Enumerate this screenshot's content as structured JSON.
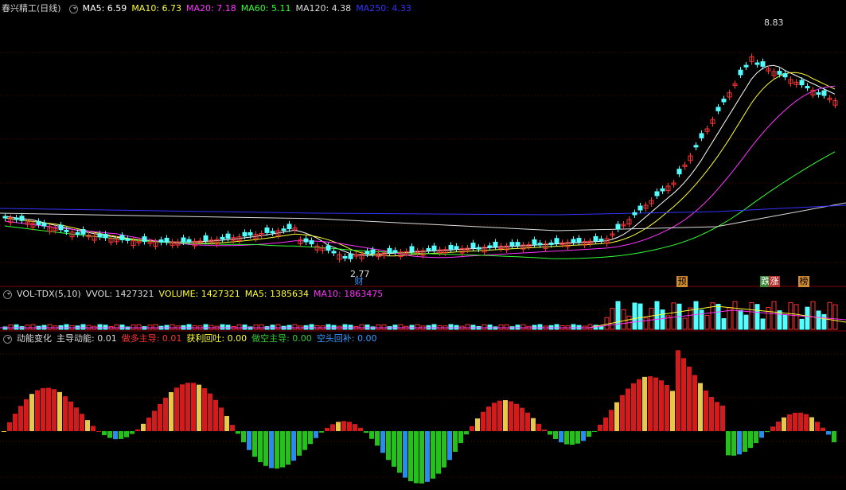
{
  "stock": {
    "name": "春兴精工",
    "period": "(日线)"
  },
  "ma_legend": [
    {
      "label": "MA5: 6.59",
      "color": "#ffffff"
    },
    {
      "label": "MA10: 6.73",
      "color": "#ffff33"
    },
    {
      "label": "MA20: 7.18",
      "color": "#ff33ff"
    },
    {
      "label": "MA60: 5.11",
      "color": "#33ff33"
    },
    {
      "label": "MA120: 4.38",
      "color": "#dddddd"
    },
    {
      "label": "MA250: 4.33",
      "color": "#3333ff"
    }
  ],
  "price": {
    "high_label": "8.83",
    "low_label": "2.77"
  },
  "event_tags": [
    "财",
    "预",
    "跌",
    "涨",
    "榜"
  ],
  "volume_legend": {
    "name": "VOL-TDX(5,10)",
    "items": [
      {
        "label": "VVOL: 1427321",
        "color": "#dddddd"
      },
      {
        "label": "VOLUME: 1427321",
        "color": "#ffff33"
      },
      {
        "label": "MA5: 1385634",
        "color": "#ffff33"
      },
      {
        "label": "MA10: 1863475",
        "color": "#ff33ff"
      }
    ]
  },
  "momentum_legend": {
    "name": "动能变化",
    "items": [
      {
        "label": "主导动能: 0.01",
        "color": "#dddddd"
      },
      {
        "label": "做多主导: 0.01",
        "color": "#ff3333"
      },
      {
        "label": "获利回吐: 0.00",
        "color": "#ffff33"
      },
      {
        "label": "做空主导: 0.00",
        "color": "#33cc33"
      },
      {
        "label": "空头回补: 0.00",
        "color": "#3399ff"
      }
    ]
  },
  "colors": {
    "up": "#ff3333",
    "down": "#54ffff",
    "grid": "#660000",
    "sep": "#800000"
  }
}
